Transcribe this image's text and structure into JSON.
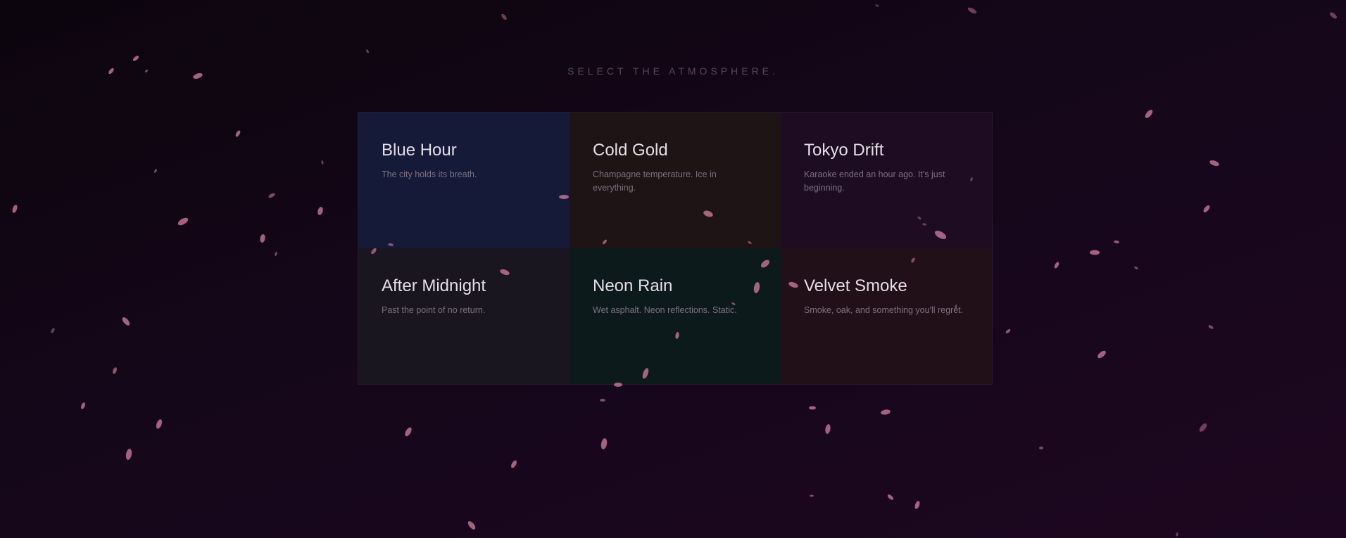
{
  "headline": "SELECT THE ATMOSPHERE.",
  "cards": [
    {
      "title": "Blue Hour",
      "description": "The city holds its breath.",
      "bg": "#141a38"
    },
    {
      "title": "Cold Gold",
      "description": "Champagne temperature. Ice in everything.",
      "bg": "#1e1415"
    },
    {
      "title": "Tokyo Drift",
      "description": "Karaoke ended an hour ago. It's just beginning.",
      "bg": "#1d0c22"
    },
    {
      "title": "After Midnight",
      "description": "Past the point of no return.",
      "bg": "#1a1620"
    },
    {
      "title": "Neon Rain",
      "description": "Wet asphalt. Neon reflections. Static.",
      "bg": "#0d1a1c"
    },
    {
      "title": "Velvet Smoke",
      "description": "Smoke, oak, and something you'll regret.",
      "bg": "#211018"
    }
  ],
  "colors": {
    "petal": "#c8789a",
    "grid_border": "#2c1a2d",
    "headline": "#5a4558"
  },
  "decoration": "falling-petals"
}
